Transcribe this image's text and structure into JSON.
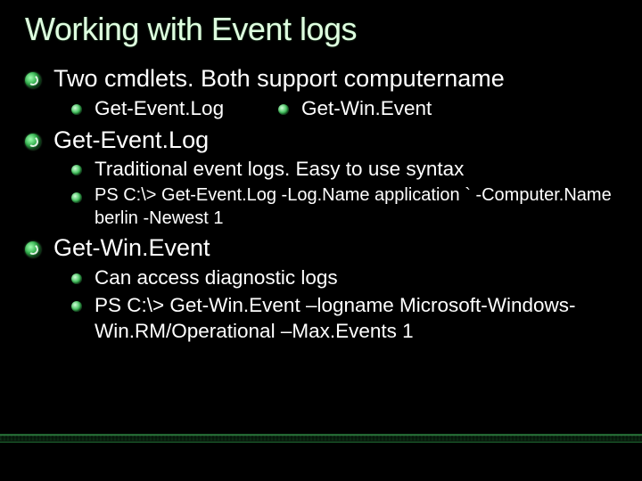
{
  "title": "Working with Event logs",
  "items": [
    {
      "text": "Two cmdlets. Both support computername",
      "sub_inline": [
        {
          "text": "Get-Event.Log"
        },
        {
          "text": "Get-Win.Event"
        }
      ]
    },
    {
      "text": "Get-Event.Log",
      "sub": [
        {
          "text": "Traditional event logs. Easy to use syntax",
          "small": false
        },
        {
          "text": "PS C:\\> Get-Event.Log -Log.Name application ` -Computer.Name berlin -Newest 1",
          "small": true
        }
      ]
    },
    {
      "text": "Get-Win.Event",
      "sub": [
        {
          "text": "Can access diagnostic logs",
          "small": false
        },
        {
          "text": "PS C:\\> Get-Win.Event –logname  Microsoft-Windows-Win.RM/Operational –Max.Events 1",
          "small": false
        }
      ]
    }
  ]
}
